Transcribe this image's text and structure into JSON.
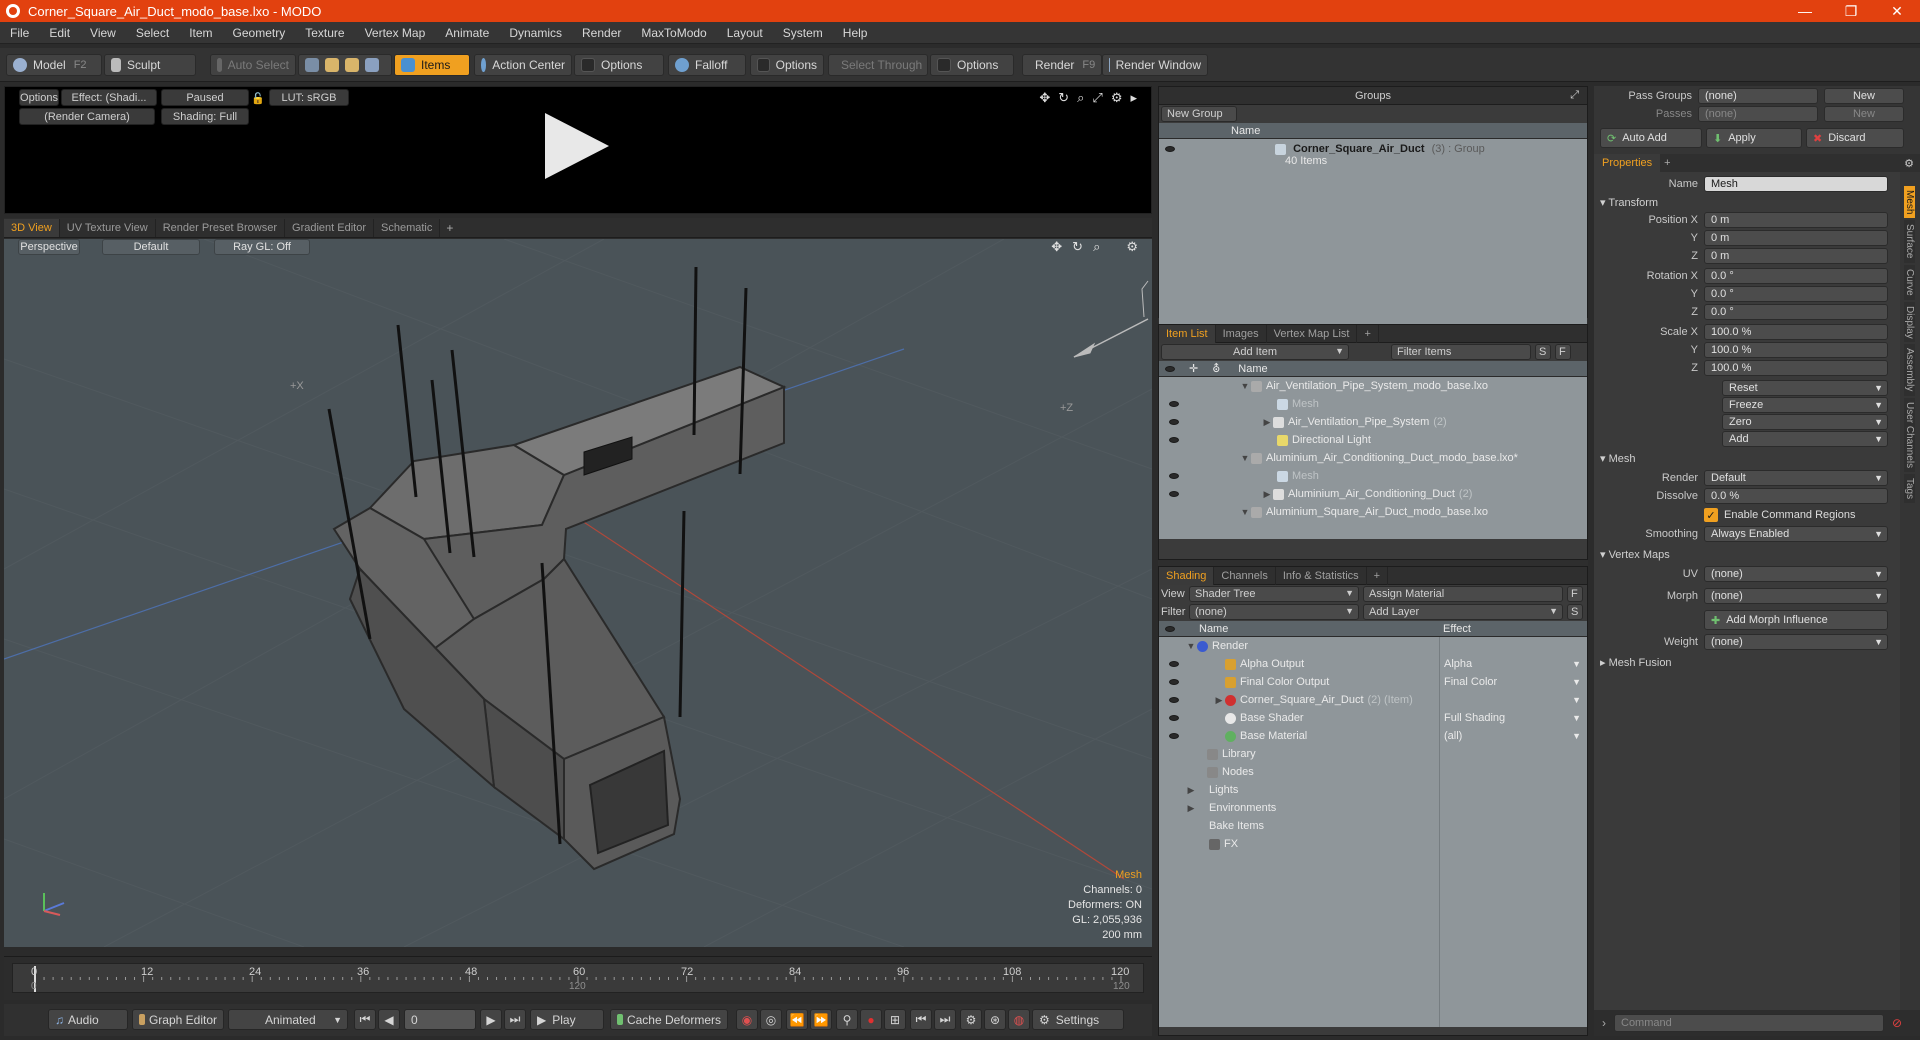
{
  "window": {
    "title": "Corner_Square_Air_Duct_modo_base.lxo - MODO",
    "min": "—",
    "max": "❐",
    "close": "✕"
  },
  "menu": [
    "File",
    "Edit",
    "View",
    "Select",
    "Item",
    "Geometry",
    "Texture",
    "Vertex Map",
    "Animate",
    "Dynamics",
    "Render",
    "MaxToModo",
    "Layout",
    "System",
    "Help"
  ],
  "toolbar": {
    "model": "Model",
    "model_key": "F2",
    "sculpt": "Sculpt",
    "auto_select": "Auto Select",
    "items": "Items",
    "action_center": "Action Center",
    "options1": "Options",
    "falloff": "Falloff",
    "options2": "Options",
    "select_through": "Select Through",
    "options3": "Options",
    "render": "Render",
    "render_key": "F9",
    "render_window": "Render Window"
  },
  "preview": {
    "options": "Options",
    "effect": "Effect: (Shadi...",
    "paused": "Paused",
    "lut": "LUT: sRGB",
    "camera": "(Render Camera)",
    "shading": "Shading: Full"
  },
  "viewtabs": [
    "3D View",
    "UV Texture View",
    "Render Preset Browser",
    "Gradient Editor",
    "Schematic"
  ],
  "viewport": {
    "perspective": "Perspective",
    "default": "Default",
    "raygl": "Ray GL: Off",
    "axis_x": "+X",
    "axis_z": "+Z",
    "info": {
      "mesh": "Mesh",
      "channels": "Channels: 0",
      "deformers": "Deformers: ON",
      "gl": "GL: 2,055,936",
      "scale": "200 mm"
    }
  },
  "timeline": {
    "top": [
      "0",
      "12",
      "24",
      "36",
      "48",
      "60",
      "72",
      "84",
      "96",
      "108",
      "120"
    ],
    "bottom": [
      "0",
      "120",
      "120"
    ]
  },
  "bottombar": {
    "audio": "Audio",
    "graph": "Graph Editor",
    "animated": "Animated",
    "frame": "0",
    "play": "Play",
    "cache": "Cache Deformers",
    "settings": "Settings"
  },
  "groups": {
    "title": "Groups",
    "new_group": "New Group",
    "col_name": "Name",
    "item_name": "Corner_Square_Air_Duct",
    "item_meta": "(3) : Group",
    "item_sub": "40 Items"
  },
  "itemlist": {
    "tabs": [
      "Item List",
      "Images",
      "Vertex Map List"
    ],
    "add_item": "Add Item",
    "filter": "Filter Items",
    "s": "S",
    "f": "F",
    "col_name": "Name",
    "rows": [
      {
        "text": "Air_Ventilation_Pipe_System_modo_base.lxo",
        "meta": ""
      },
      {
        "text": "Mesh",
        "meta": ""
      },
      {
        "text": "Air_Ventilation_Pipe_System",
        "meta": "(2)"
      },
      {
        "text": "Directional Light",
        "meta": ""
      },
      {
        "text": "Aluminium_Air_Conditioning_Duct_modo_base.lxo*",
        "meta": ""
      },
      {
        "text": "Mesh",
        "meta": ""
      },
      {
        "text": "Aluminium_Air_Conditioning_Duct",
        "meta": "(2)"
      },
      {
        "text": "Aluminium_Square_Air_Duct_modo_base.lxo",
        "meta": ""
      }
    ]
  },
  "shading": {
    "tabs": [
      "Shading",
      "Channels",
      "Info & Statistics"
    ],
    "view_label": "View",
    "view_value": "Shader Tree",
    "assign": "Assign Material",
    "f": "F",
    "filter_label": "Filter",
    "filter_value": "(none)",
    "add_layer": "Add Layer",
    "s": "S",
    "col_name": "Name",
    "col_effect": "Effect",
    "rows": [
      {
        "name": "Render",
        "meta": "",
        "effect": ""
      },
      {
        "name": "Alpha Output",
        "meta": "",
        "effect": "Alpha"
      },
      {
        "name": "Final Color Output",
        "meta": "",
        "effect": "Final Color"
      },
      {
        "name": "Corner_Square_Air_Duct",
        "meta": "(2) (Item)",
        "effect": ""
      },
      {
        "name": "Base Shader",
        "meta": "",
        "effect": "Full Shading"
      },
      {
        "name": "Base Material",
        "meta": "",
        "effect": "(all)"
      },
      {
        "name": "Library",
        "meta": "",
        "effect": ""
      },
      {
        "name": "Nodes",
        "meta": "",
        "effect": ""
      },
      {
        "name": "Lights",
        "meta": "",
        "effect": ""
      },
      {
        "name": "Environments",
        "meta": "",
        "effect": ""
      },
      {
        "name": "Bake Items",
        "meta": "",
        "effect": ""
      },
      {
        "name": "FX",
        "meta": "",
        "effect": ""
      }
    ]
  },
  "right": {
    "pass_groups": "Pass Groups",
    "pass_groups_value": "(none)",
    "new": "New",
    "passes": "Passes",
    "passes_value": "(none)",
    "new2": "New",
    "auto_add": "Auto Add",
    "apply": "Apply",
    "discard": "Discard",
    "properties": "Properties",
    "name_label": "Name",
    "name_value": "Mesh",
    "transform": "Transform",
    "position_x": "Position X",
    "y": "Y",
    "z": "Z",
    "pos": [
      "0 m",
      "0 m",
      "0 m"
    ],
    "rotation_x": "Rotation X",
    "rot": [
      "0.0 °",
      "0.0 °",
      "0.0 °"
    ],
    "scale_x": "Scale X",
    "scl": [
      "100.0 %",
      "100.0 %",
      "100.0 %"
    ],
    "reset": "Reset",
    "freeze": "Freeze",
    "zero": "Zero",
    "add": "Add",
    "mesh_sec": "Mesh",
    "render_label": "Render",
    "render_value": "Default",
    "dissolve_label": "Dissolve",
    "dissolve_value": "0.0 %",
    "enable_cmd": "Enable Command Regions",
    "smoothing_label": "Smoothing",
    "smoothing_value": "Always Enabled",
    "vertex_maps": "Vertex Maps",
    "uv_label": "UV",
    "uv_value": "(none)",
    "morph_label": "Morph",
    "morph_value": "(none)",
    "add_morph": "Add Morph Influence",
    "weight_label": "Weight",
    "weight_value": "(none)",
    "mesh_fusion": "Mesh Fusion",
    "command": "Command",
    "vtabs": [
      "Mesh",
      "Surface",
      "Curve",
      "Display",
      "Assembly",
      "User Channels",
      "Tags"
    ]
  },
  "colors": {
    "accent": "#f0a020",
    "title_bar": "#e2410f",
    "viewport_bg": "#4a5358"
  }
}
